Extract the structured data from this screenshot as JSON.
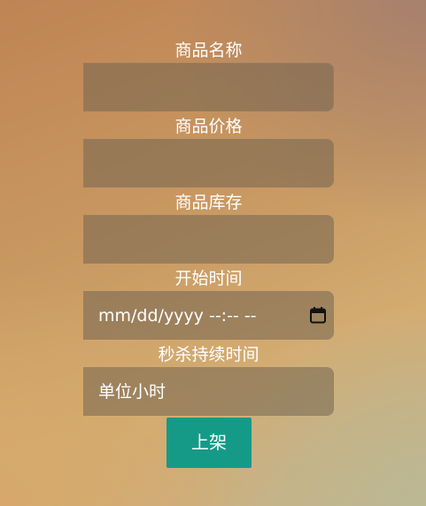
{
  "form": {
    "fields": [
      {
        "label": "商品名称",
        "value": ""
      },
      {
        "label": "商品价格",
        "value": ""
      },
      {
        "label": "商品库存",
        "value": ""
      },
      {
        "label": "开始时间",
        "value": "mm/dd/yyyy --:-- --"
      },
      {
        "label": "秒杀持续时间",
        "placeholder": "单位小时"
      }
    ],
    "submit_label": "上架"
  },
  "icons": {
    "start_time_picker": "calendar-icon"
  }
}
